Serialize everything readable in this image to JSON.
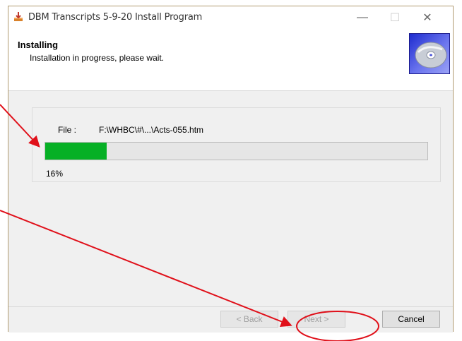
{
  "window": {
    "title": "DBM Transcripts 5-9-20 Install Program",
    "controls": {
      "minimize": "—",
      "maximize": "☐",
      "close": "✕"
    }
  },
  "header": {
    "title": "Installing",
    "subtitle": "Installation in progress, please wait.",
    "image_icon": "cd-disc-icon"
  },
  "progress_section": {
    "file_label": "File :",
    "file_path": "F:\\WHBC\\#\\...\\Acts-055.htm",
    "progress_fraction": 0.16,
    "percent_text": "16%"
  },
  "buttons": {
    "back": "< Back",
    "next": "Next >",
    "cancel": "Cancel"
  },
  "colors": {
    "progress_fill": "#06b025",
    "annotation_red": "#e0101a",
    "header_cd_blue": "#2a36d6"
  }
}
